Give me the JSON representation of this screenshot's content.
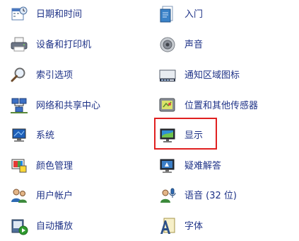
{
  "colors": {
    "link": "#1e3287",
    "highlight_border": "#e02020"
  },
  "left_items": [
    {
      "label": "日期和时间",
      "icon": "calendar-clock-icon"
    },
    {
      "label": "设备和打印机",
      "icon": "printer-icon"
    },
    {
      "label": "索引选项",
      "icon": "magnifier-index-icon"
    },
    {
      "label": "网络和共享中心",
      "icon": "network-icon"
    },
    {
      "label": "系统",
      "icon": "system-computer-icon"
    },
    {
      "label": "颜色管理",
      "icon": "color-management-icon"
    },
    {
      "label": "用户帐户",
      "icon": "user-accounts-icon"
    },
    {
      "label": "自动播放",
      "icon": "autoplay-icon"
    }
  ],
  "right_items": [
    {
      "label": "入门",
      "icon": "getting-started-icon"
    },
    {
      "label": "声音",
      "icon": "speaker-icon"
    },
    {
      "label": "通知区域图标",
      "icon": "notification-area-icon"
    },
    {
      "label": "位置和其他传感器",
      "icon": "location-sensor-icon"
    },
    {
      "label": "显示",
      "icon": "display-monitor-icon"
    },
    {
      "label": "疑难解答",
      "icon": "troubleshooting-icon"
    },
    {
      "label": "语音 (32 位)",
      "icon": "speech-microphone-icon"
    },
    {
      "label": "字体",
      "icon": "fonts-icon"
    }
  ]
}
